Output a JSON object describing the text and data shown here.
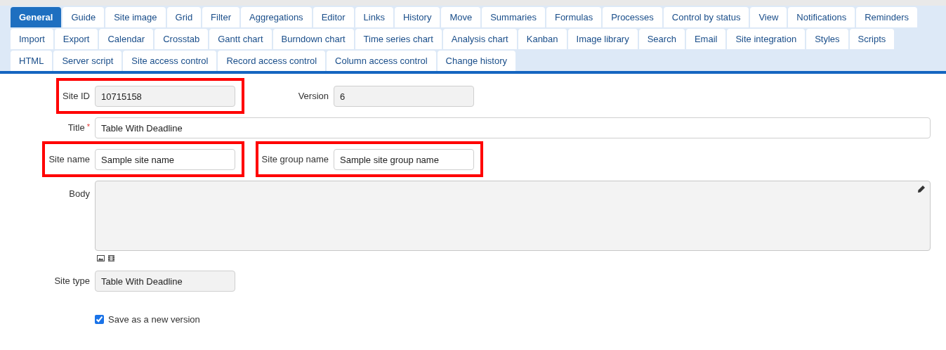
{
  "tab_rows": [
    [
      {
        "label": "General",
        "selected": true
      },
      {
        "label": "Guide",
        "selected": false
      },
      {
        "label": "Site image",
        "selected": false
      },
      {
        "label": "Grid",
        "selected": false
      },
      {
        "label": "Filter",
        "selected": false
      },
      {
        "label": "Aggregations",
        "selected": false
      },
      {
        "label": "Editor",
        "selected": false
      },
      {
        "label": "Links",
        "selected": false
      },
      {
        "label": "History",
        "selected": false
      },
      {
        "label": "Move",
        "selected": false
      },
      {
        "label": "Summaries",
        "selected": false
      },
      {
        "label": "Formulas",
        "selected": false
      },
      {
        "label": "Processes",
        "selected": false
      },
      {
        "label": "Control by status",
        "selected": false
      },
      {
        "label": "View",
        "selected": false
      },
      {
        "label": "Notifications",
        "selected": false
      },
      {
        "label": "Reminders",
        "selected": false
      }
    ],
    [
      {
        "label": "Import",
        "selected": false
      },
      {
        "label": "Export",
        "selected": false
      },
      {
        "label": "Calendar",
        "selected": false
      },
      {
        "label": "Crosstab",
        "selected": false
      },
      {
        "label": "Gantt chart",
        "selected": false
      },
      {
        "label": "Burndown chart",
        "selected": false
      },
      {
        "label": "Time series chart",
        "selected": false
      },
      {
        "label": "Analysis chart",
        "selected": false
      },
      {
        "label": "Kanban",
        "selected": false
      },
      {
        "label": "Image library",
        "selected": false
      },
      {
        "label": "Search",
        "selected": false
      },
      {
        "label": "Email",
        "selected": false
      },
      {
        "label": "Site integration",
        "selected": false
      },
      {
        "label": "Styles",
        "selected": false
      },
      {
        "label": "Scripts",
        "selected": false
      }
    ],
    [
      {
        "label": "HTML",
        "selected": false
      },
      {
        "label": "Server script",
        "selected": false
      },
      {
        "label": "Site access control",
        "selected": false
      },
      {
        "label": "Record access control",
        "selected": false
      },
      {
        "label": "Column access control",
        "selected": false
      },
      {
        "label": "Change history",
        "selected": false
      }
    ]
  ],
  "form_rows": [
    {
      "kind": "pair",
      "fields": [
        {
          "label": "Site ID",
          "value": "10715158",
          "readonly": true,
          "highlighted": true
        },
        {
          "label": "Version",
          "value": "6",
          "readonly": true,
          "highlighted": false
        }
      ]
    },
    {
      "kind": "long",
      "fields": [
        {
          "label": "Title",
          "required_mark": "*",
          "value": "Table With Deadline",
          "readonly": false,
          "highlighted": false
        }
      ]
    },
    {
      "kind": "pair",
      "fields": [
        {
          "label": "Site name",
          "value": "Sample site name",
          "readonly": false,
          "highlighted": true
        },
        {
          "label": "Site group name",
          "value": "Sample site group name",
          "readonly": false,
          "highlighted": true
        }
      ]
    },
    {
      "kind": "textarea",
      "fields": [
        {
          "label": "Body",
          "readonly": true
        }
      ]
    },
    {
      "kind": "pair",
      "fields": [
        {
          "label": "Site type",
          "value": "Table With Deadline",
          "readonly": true,
          "highlighted": false
        }
      ]
    },
    {
      "kind": "checkbox",
      "fields": [
        {
          "label": "Save as a new version",
          "checked": true
        }
      ]
    }
  ]
}
